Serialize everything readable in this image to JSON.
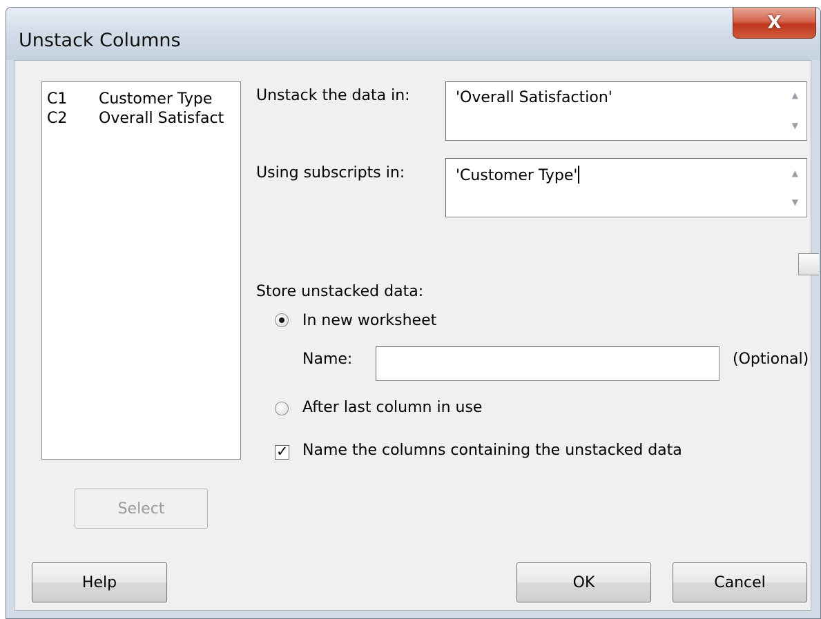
{
  "window": {
    "title": "Unstack Columns",
    "close_label": "X"
  },
  "variables_list": [
    {
      "id": "C1",
      "name": "Customer Type"
    },
    {
      "id": "C2",
      "name": "Overall Satisfact"
    }
  ],
  "unstack": {
    "label": "Unstack the data in:",
    "value": "'Overall Satisfaction'"
  },
  "subscripts": {
    "label": "Using subscripts in:",
    "value": "'Customer Type'"
  },
  "store": {
    "label": "Store unstacked data:",
    "new_worksheet_label": "In new worksheet",
    "new_worksheet_selected": true,
    "name_label": "Name:",
    "name_value": "",
    "optional_label": "(Optional)",
    "after_last_label": "After last column in use",
    "after_last_selected": false
  },
  "name_columns": {
    "label": "Name the columns containing the unstacked data",
    "checked": true
  },
  "buttons": {
    "select": "Select",
    "help": "Help",
    "ok": "OK",
    "cancel": "Cancel"
  },
  "icons": {
    "scroll_up": "scroll-up-arrow-icon",
    "scroll_down": "scroll-down-arrow-icon",
    "close": "close-icon",
    "check": "check-icon"
  }
}
